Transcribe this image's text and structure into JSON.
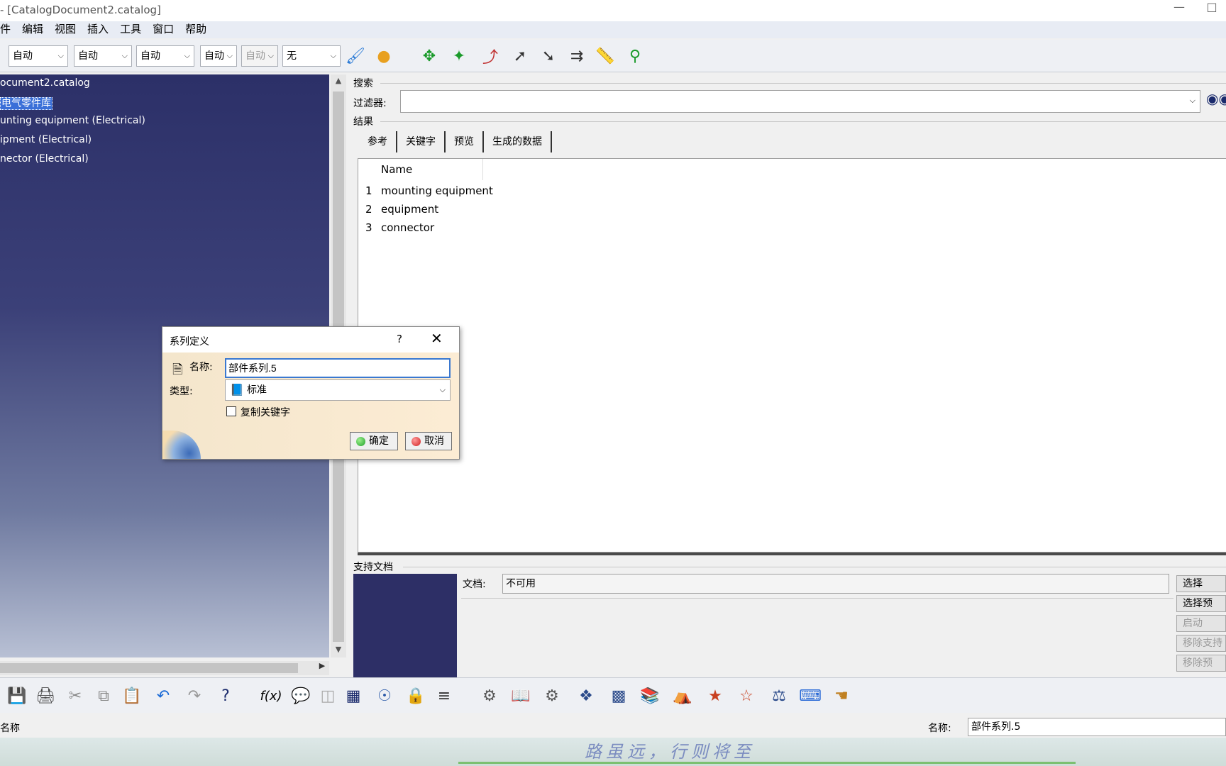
{
  "window": {
    "title": "- [CatalogDocument2.catalog]",
    "minimize": "—",
    "maximize": "□"
  },
  "menu": [
    "件",
    "编辑",
    "视图",
    "插入",
    "工具",
    "窗口",
    "帮助"
  ],
  "toolbar": {
    "selects": [
      {
        "value": "自动",
        "disabled": false
      },
      {
        "value": "自动",
        "disabled": false
      },
      {
        "value": "自动",
        "disabled": false
      },
      {
        "value": "自动",
        "disabled": false
      },
      {
        "value": "自动",
        "disabled": true
      },
      {
        "value": "无",
        "disabled": false
      }
    ],
    "icons": [
      "paint-brush-icon",
      "color-ball-icon",
      "pan-icon",
      "rotate-icon",
      "snap-point-icon",
      "point-icon",
      "line-icon",
      "distance-icon",
      "measure-icon",
      "measure-item-icon"
    ]
  },
  "tree": {
    "items": [
      {
        "label": "ocument2.catalog",
        "selected": false
      },
      {
        "label": "电气零件库",
        "selected": true
      },
      {
        "label": "unting equipment (Electrical)",
        "selected": false
      },
      {
        "label": "ipment (Electrical)",
        "selected": false
      },
      {
        "label": "nector (Electrical)",
        "selected": false
      }
    ]
  },
  "search": {
    "group_label": "搜索",
    "filter_label": "过滤器:",
    "filter_value": "",
    "results_label": "结果",
    "tabs": [
      "参考",
      "关键字",
      "预览",
      "生成的数据"
    ],
    "active_tab": 0,
    "column_header": "Name",
    "rows": [
      {
        "num": "1",
        "name": "mounting equipment"
      },
      {
        "num": "2",
        "name": "equipment"
      },
      {
        "num": "3",
        "name": "connector"
      }
    ]
  },
  "support": {
    "group_label": "支持文档",
    "doc_label": "文档:",
    "doc_value": "不可用",
    "buttons": [
      {
        "label": "选择",
        "disabled": false
      },
      {
        "label": "选择预",
        "disabled": false
      },
      {
        "label": "启动",
        "disabled": true
      },
      {
        "label": "移除支持",
        "disabled": true
      },
      {
        "label": "移除预",
        "disabled": true
      }
    ]
  },
  "bottom_toolbar": [
    "save-icon",
    "print-icon",
    "cut-icon",
    "copy-icon",
    "paste-icon",
    "undo-icon",
    "redo-icon",
    "whats-this-icon",
    "formula-icon",
    "knowledge-icon",
    "design-table-icon",
    "table-icon",
    "tree-icon",
    "lock-icon",
    "feature-icon",
    "gear-icon",
    "catalog-icon",
    "settings-icon",
    "component-icon",
    "family-icon",
    "chapter-icon",
    "part-icon",
    "resolved-icon",
    "query-icon",
    "generate-icon",
    "keyword-icon",
    "pointer-icon"
  ],
  "status": {
    "text": "名称",
    "name_label": "名称:",
    "name_value": "部件系列.5"
  },
  "wallpaper": {
    "slogan": "路虽远，行则将至"
  },
  "dialog": {
    "title": "系列定义",
    "help": "?",
    "close": "✕",
    "name_label": "名称:",
    "name_value": "部件系列.5",
    "type_label": "类型:",
    "type_value": "标准",
    "copy_keywords_label": "复制关键字",
    "copy_keywords_checked": false,
    "ok_label": "确定",
    "cancel_label": "取消",
    "ok_color": "#1fa02a",
    "cancel_color": "#d02020"
  }
}
